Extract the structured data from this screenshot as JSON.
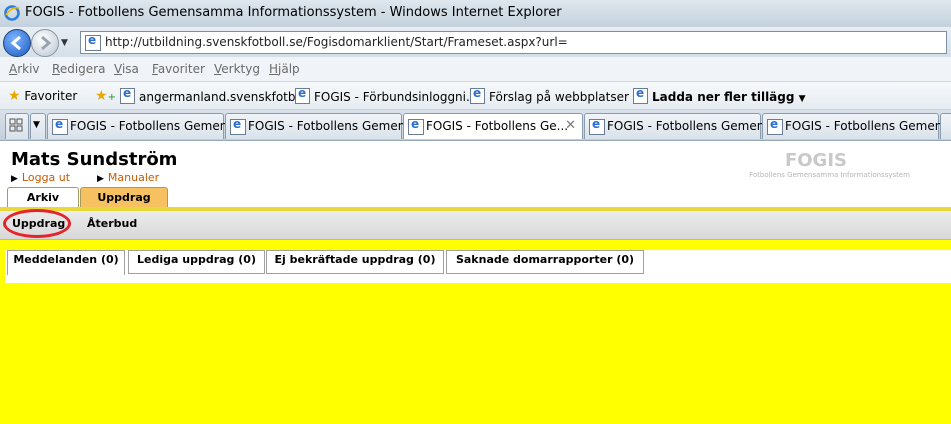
{
  "window": {
    "title": "FOGIS - Fotbollens Gemensamma Informationssystem - Windows Internet Explorer"
  },
  "address": {
    "url": "http://utbildning.svenskfotboll.se/Fogisdomarklient/Start/Frameset.aspx?url="
  },
  "menu": [
    "Arkiv",
    "Redigera",
    "Visa",
    "Favoriter",
    "Verktyg",
    "Hjälp"
  ],
  "favorites": {
    "label": "Favoriter",
    "items": [
      "angermanland.svenskfotb...",
      "FOGIS - Förbundsinloggni...",
      "Förslag på webbplatser",
      "Ladda ner fler tillägg"
    ]
  },
  "browser_tabs": [
    "FOGIS - Fotbollens Gemen...",
    "FOGIS - Fotbollens Gemen...",
    "FOGIS - Fotbollens Ge...",
    "FOGIS - Fotbollens Gemen...",
    "FOGIS - Fotbollens Gemen..."
  ],
  "page": {
    "user_name": "Mats Sundström",
    "logout": "Logga ut",
    "manuals": "Manualer",
    "logo": "FOGIS",
    "logo_sub": "Fotbollens Gemensamma Informationssystem",
    "main_tabs": [
      "Arkiv",
      "Uppdrag"
    ],
    "sub_nav": [
      "Uppdrag",
      "Återbud"
    ],
    "content_tabs": [
      "Meddelanden (0)",
      "Lediga uppdrag (0)",
      "Ej bekräftade uppdrag (0)",
      "Saknade domarrapporter (0)"
    ]
  },
  "colors": {
    "page_bg": "#ffff00",
    "active_tab": "#f7c060",
    "highlight_circle": "#e3242b",
    "link": "#c85a00"
  }
}
